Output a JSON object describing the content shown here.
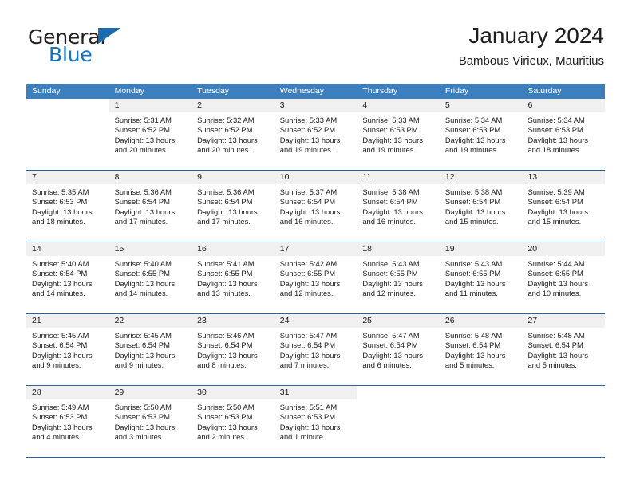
{
  "logo": {
    "word_one": "General",
    "word_two": "Blue",
    "triangle": "triangle-mark",
    "accent_color": "#1573bf"
  },
  "header": {
    "title": "January 2024",
    "location": "Bambous Virieux, Mauritius"
  },
  "calendar": {
    "header_bg": "#3d7ebd",
    "divider_color": "#1f67ad",
    "day_band_bg": "#f0f0f0",
    "weekdays": [
      "Sunday",
      "Monday",
      "Tuesday",
      "Wednesday",
      "Thursday",
      "Friday",
      "Saturday"
    ],
    "weeks": [
      [
        {
          "empty": true
        },
        {
          "day": "1",
          "sunrise": "Sunrise: 5:31 AM",
          "sunset": "Sunset: 6:52 PM",
          "daylight1": "Daylight: 13 hours",
          "daylight2": "and 20 minutes."
        },
        {
          "day": "2",
          "sunrise": "Sunrise: 5:32 AM",
          "sunset": "Sunset: 6:52 PM",
          "daylight1": "Daylight: 13 hours",
          "daylight2": "and 20 minutes."
        },
        {
          "day": "3",
          "sunrise": "Sunrise: 5:33 AM",
          "sunset": "Sunset: 6:52 PM",
          "daylight1": "Daylight: 13 hours",
          "daylight2": "and 19 minutes."
        },
        {
          "day": "4",
          "sunrise": "Sunrise: 5:33 AM",
          "sunset": "Sunset: 6:53 PM",
          "daylight1": "Daylight: 13 hours",
          "daylight2": "and 19 minutes."
        },
        {
          "day": "5",
          "sunrise": "Sunrise: 5:34 AM",
          "sunset": "Sunset: 6:53 PM",
          "daylight1": "Daylight: 13 hours",
          "daylight2": "and 19 minutes."
        },
        {
          "day": "6",
          "sunrise": "Sunrise: 5:34 AM",
          "sunset": "Sunset: 6:53 PM",
          "daylight1": "Daylight: 13 hours",
          "daylight2": "and 18 minutes."
        }
      ],
      [
        {
          "day": "7",
          "sunrise": "Sunrise: 5:35 AM",
          "sunset": "Sunset: 6:53 PM",
          "daylight1": "Daylight: 13 hours",
          "daylight2": "and 18 minutes."
        },
        {
          "day": "8",
          "sunrise": "Sunrise: 5:36 AM",
          "sunset": "Sunset: 6:54 PM",
          "daylight1": "Daylight: 13 hours",
          "daylight2": "and 17 minutes."
        },
        {
          "day": "9",
          "sunrise": "Sunrise: 5:36 AM",
          "sunset": "Sunset: 6:54 PM",
          "daylight1": "Daylight: 13 hours",
          "daylight2": "and 17 minutes."
        },
        {
          "day": "10",
          "sunrise": "Sunrise: 5:37 AM",
          "sunset": "Sunset: 6:54 PM",
          "daylight1": "Daylight: 13 hours",
          "daylight2": "and 16 minutes."
        },
        {
          "day": "11",
          "sunrise": "Sunrise: 5:38 AM",
          "sunset": "Sunset: 6:54 PM",
          "daylight1": "Daylight: 13 hours",
          "daylight2": "and 16 minutes."
        },
        {
          "day": "12",
          "sunrise": "Sunrise: 5:38 AM",
          "sunset": "Sunset: 6:54 PM",
          "daylight1": "Daylight: 13 hours",
          "daylight2": "and 15 minutes."
        },
        {
          "day": "13",
          "sunrise": "Sunrise: 5:39 AM",
          "sunset": "Sunset: 6:54 PM",
          "daylight1": "Daylight: 13 hours",
          "daylight2": "and 15 minutes."
        }
      ],
      [
        {
          "day": "14",
          "sunrise": "Sunrise: 5:40 AM",
          "sunset": "Sunset: 6:54 PM",
          "daylight1": "Daylight: 13 hours",
          "daylight2": "and 14 minutes."
        },
        {
          "day": "15",
          "sunrise": "Sunrise: 5:40 AM",
          "sunset": "Sunset: 6:55 PM",
          "daylight1": "Daylight: 13 hours",
          "daylight2": "and 14 minutes."
        },
        {
          "day": "16",
          "sunrise": "Sunrise: 5:41 AM",
          "sunset": "Sunset: 6:55 PM",
          "daylight1": "Daylight: 13 hours",
          "daylight2": "and 13 minutes."
        },
        {
          "day": "17",
          "sunrise": "Sunrise: 5:42 AM",
          "sunset": "Sunset: 6:55 PM",
          "daylight1": "Daylight: 13 hours",
          "daylight2": "and 12 minutes."
        },
        {
          "day": "18",
          "sunrise": "Sunrise: 5:43 AM",
          "sunset": "Sunset: 6:55 PM",
          "daylight1": "Daylight: 13 hours",
          "daylight2": "and 12 minutes."
        },
        {
          "day": "19",
          "sunrise": "Sunrise: 5:43 AM",
          "sunset": "Sunset: 6:55 PM",
          "daylight1": "Daylight: 13 hours",
          "daylight2": "and 11 minutes."
        },
        {
          "day": "20",
          "sunrise": "Sunrise: 5:44 AM",
          "sunset": "Sunset: 6:55 PM",
          "daylight1": "Daylight: 13 hours",
          "daylight2": "and 10 minutes."
        }
      ],
      [
        {
          "day": "21",
          "sunrise": "Sunrise: 5:45 AM",
          "sunset": "Sunset: 6:54 PM",
          "daylight1": "Daylight: 13 hours",
          "daylight2": "and 9 minutes."
        },
        {
          "day": "22",
          "sunrise": "Sunrise: 5:45 AM",
          "sunset": "Sunset: 6:54 PM",
          "daylight1": "Daylight: 13 hours",
          "daylight2": "and 9 minutes."
        },
        {
          "day": "23",
          "sunrise": "Sunrise: 5:46 AM",
          "sunset": "Sunset: 6:54 PM",
          "daylight1": "Daylight: 13 hours",
          "daylight2": "and 8 minutes."
        },
        {
          "day": "24",
          "sunrise": "Sunrise: 5:47 AM",
          "sunset": "Sunset: 6:54 PM",
          "daylight1": "Daylight: 13 hours",
          "daylight2": "and 7 minutes."
        },
        {
          "day": "25",
          "sunrise": "Sunrise: 5:47 AM",
          "sunset": "Sunset: 6:54 PM",
          "daylight1": "Daylight: 13 hours",
          "daylight2": "and 6 minutes."
        },
        {
          "day": "26",
          "sunrise": "Sunrise: 5:48 AM",
          "sunset": "Sunset: 6:54 PM",
          "daylight1": "Daylight: 13 hours",
          "daylight2": "and 5 minutes."
        },
        {
          "day": "27",
          "sunrise": "Sunrise: 5:48 AM",
          "sunset": "Sunset: 6:54 PM",
          "daylight1": "Daylight: 13 hours",
          "daylight2": "and 5 minutes."
        }
      ],
      [
        {
          "day": "28",
          "sunrise": "Sunrise: 5:49 AM",
          "sunset": "Sunset: 6:53 PM",
          "daylight1": "Daylight: 13 hours",
          "daylight2": "and 4 minutes."
        },
        {
          "day": "29",
          "sunrise": "Sunrise: 5:50 AM",
          "sunset": "Sunset: 6:53 PM",
          "daylight1": "Daylight: 13 hours",
          "daylight2": "and 3 minutes."
        },
        {
          "day": "30",
          "sunrise": "Sunrise: 5:50 AM",
          "sunset": "Sunset: 6:53 PM",
          "daylight1": "Daylight: 13 hours",
          "daylight2": "and 2 minutes."
        },
        {
          "day": "31",
          "sunrise": "Sunrise: 5:51 AM",
          "sunset": "Sunset: 6:53 PM",
          "daylight1": "Daylight: 13 hours",
          "daylight2": "and 1 minute."
        },
        {
          "empty": true
        },
        {
          "empty": true
        },
        {
          "empty": true
        }
      ]
    ]
  }
}
